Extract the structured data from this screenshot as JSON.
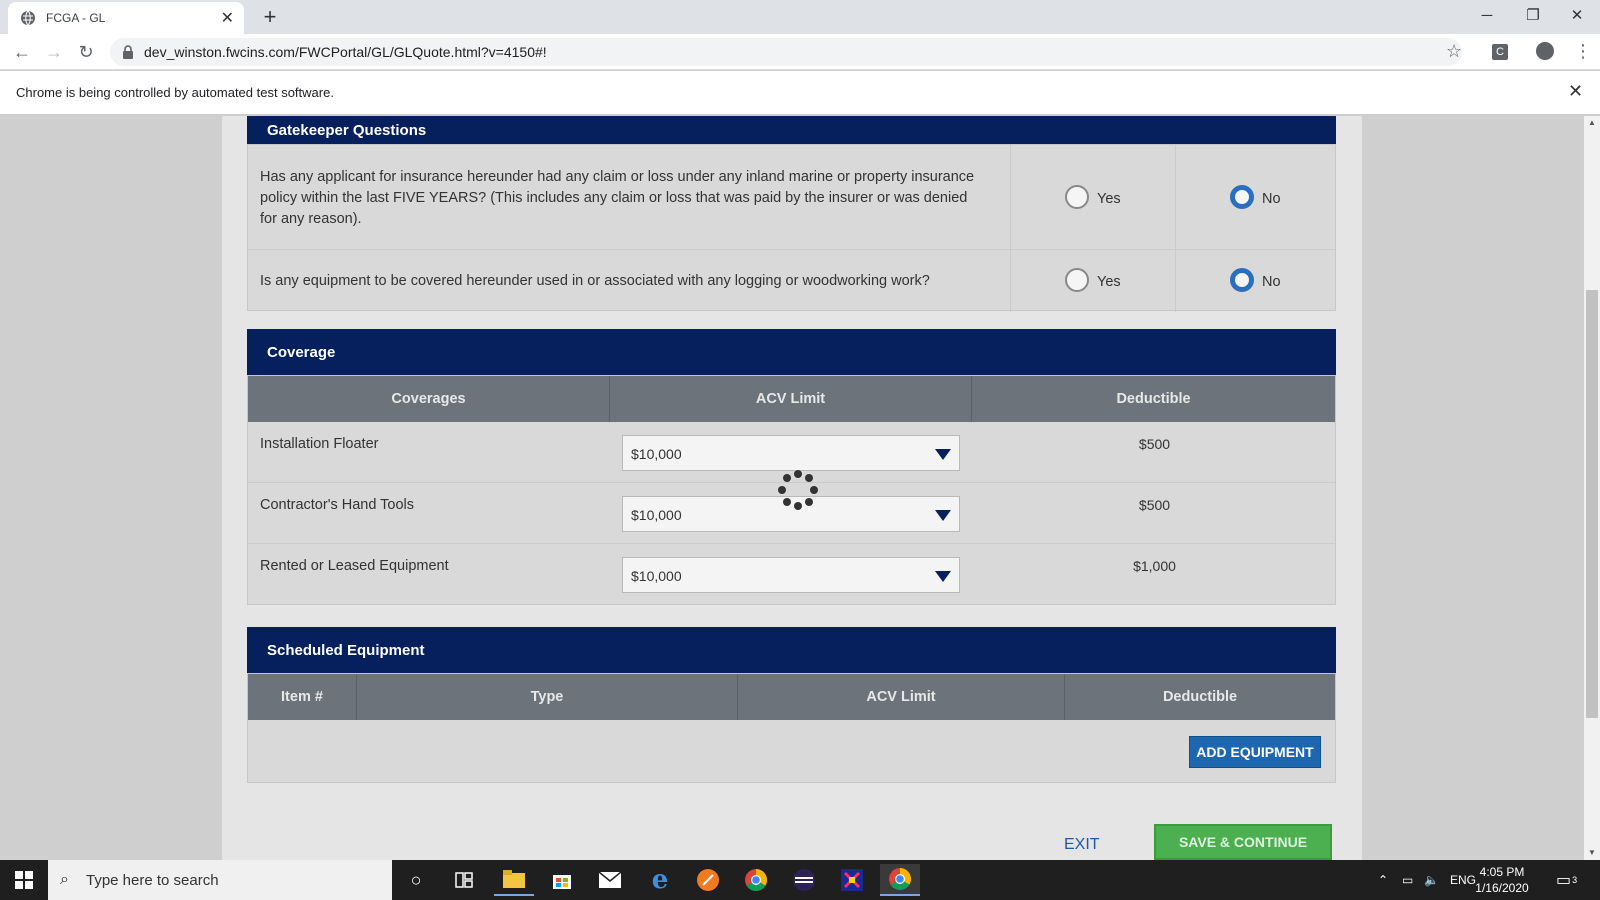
{
  "browser": {
    "tab_title": "FCGA - GL",
    "url": "dev_winston.fwcins.com/FWCPortal/GL/GLQuote.html?v=4150#!",
    "infobar_message": "Chrome is being controlled by automated test software.",
    "extension_label": "C"
  },
  "gatekeeper": {
    "title": "Gatekeeper Questions",
    "questions": [
      {
        "text": "Has any applicant for insurance hereunder had any claim or loss under any inland marine or property insurance policy within the last FIVE YEARS? (This includes any claim or loss that was paid by the insurer or was denied for any reason).",
        "yes_label": "Yes",
        "no_label": "No",
        "selected": "No"
      },
      {
        "text": "Is any equipment to be covered hereunder used in or associated with any logging or woodworking work?",
        "yes_label": "Yes",
        "no_label": "No",
        "selected": "No"
      }
    ]
  },
  "coverage": {
    "title": "Coverage",
    "headers": [
      "Coverages",
      "ACV Limit",
      "Deductible"
    ],
    "rows": [
      {
        "name": "Installation Floater",
        "limit": "$10,000",
        "deductible": "$500"
      },
      {
        "name": "Contractor's Hand Tools",
        "limit": "$10,000",
        "deductible": "$500"
      },
      {
        "name": "Rented or Leased Equipment",
        "limit": "$10,000",
        "deductible": "$1,000"
      }
    ]
  },
  "scheduled": {
    "title": "Scheduled Equipment",
    "headers": [
      "Item #",
      "Type",
      "ACV Limit",
      "Deductible"
    ],
    "add_button": "ADD EQUIPMENT"
  },
  "actions": {
    "exit": "EXIT",
    "save": "SAVE & CONTINUE"
  },
  "taskbar": {
    "search_placeholder": "Type here to search",
    "language": "ENG",
    "time": "4:05 PM",
    "date": "1/16/2020",
    "notification_count": "3"
  },
  "colors": {
    "section_header": "#06205e",
    "table_header": "#6c737a",
    "radio_selected": "#2a6fbf",
    "add_button": "#1d67b0",
    "save_button": "#4caf50"
  }
}
